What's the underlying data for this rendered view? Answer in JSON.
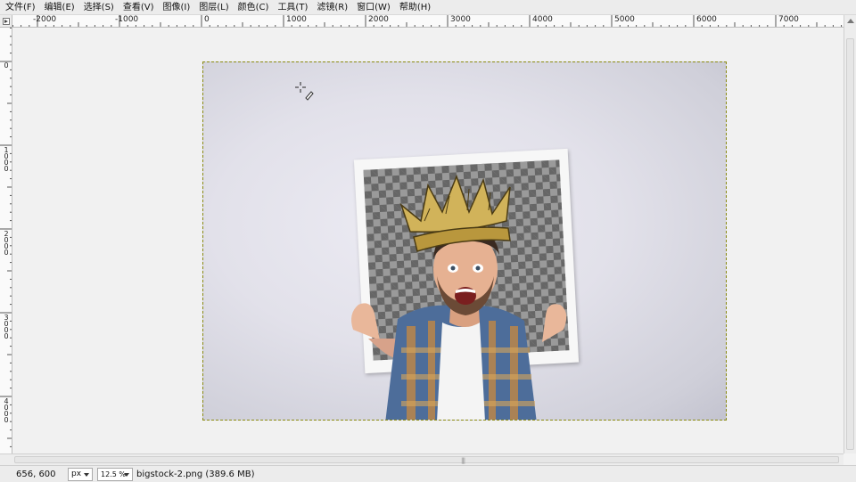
{
  "menubar": {
    "items": [
      "文件(F)",
      "编辑(E)",
      "选择(S)",
      "查看(V)",
      "图像(I)",
      "图层(L)",
      "颜色(C)",
      "工具(T)",
      "滤镜(R)",
      "窗口(W)",
      "帮助(H)"
    ]
  },
  "hruler": {
    "labels": [
      "-2000",
      "-1000",
      "0",
      "1000",
      "2000",
      "3000",
      "4000",
      "5000",
      "6000",
      "7000"
    ]
  },
  "vruler": {
    "labels": [
      "0",
      "1000",
      "2000",
      "3000",
      "4000"
    ]
  },
  "statusbar": {
    "coords": "656, 600",
    "unit": "px",
    "zoom": "12.5 %",
    "message": "bigstock-2.png (389.6 MB)"
  },
  "colors": {
    "selection_border": "#8a8a12",
    "canvas_bg": "#f1f1f1"
  }
}
